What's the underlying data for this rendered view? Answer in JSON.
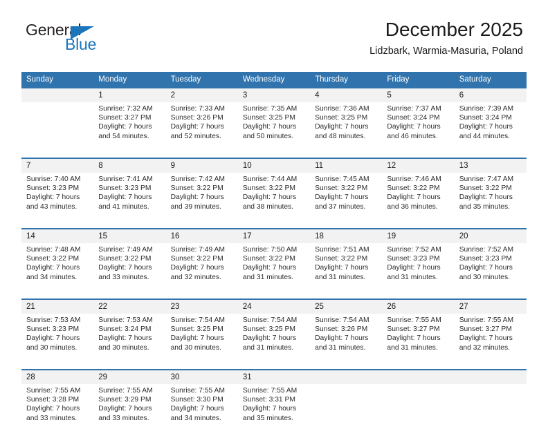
{
  "brand": {
    "line1": "General",
    "line2": "Blue",
    "triangle_icon": "brand-triangle-icon",
    "accent_color": "#1b75bb"
  },
  "header": {
    "title": "December 2025",
    "subtitle": "Lidzbark, Warmia-Masuria, Poland"
  },
  "theme": {
    "header_bg": "#3174ad",
    "daynum_bg": "#f2f2f2",
    "text": "#1a1a1a"
  },
  "weekday_headers": [
    "Sunday",
    "Monday",
    "Tuesday",
    "Wednesday",
    "Thursday",
    "Friday",
    "Saturday"
  ],
  "weeks": [
    {
      "days": [
        {
          "num": "",
          "sunrise": "",
          "sunset": "",
          "daylight1": "",
          "daylight2": ""
        },
        {
          "num": "1",
          "sunrise": "Sunrise: 7:32 AM",
          "sunset": "Sunset: 3:27 PM",
          "daylight1": "Daylight: 7 hours",
          "daylight2": "and 54 minutes."
        },
        {
          "num": "2",
          "sunrise": "Sunrise: 7:33 AM",
          "sunset": "Sunset: 3:26 PM",
          "daylight1": "Daylight: 7 hours",
          "daylight2": "and 52 minutes."
        },
        {
          "num": "3",
          "sunrise": "Sunrise: 7:35 AM",
          "sunset": "Sunset: 3:25 PM",
          "daylight1": "Daylight: 7 hours",
          "daylight2": "and 50 minutes."
        },
        {
          "num": "4",
          "sunrise": "Sunrise: 7:36 AM",
          "sunset": "Sunset: 3:25 PM",
          "daylight1": "Daylight: 7 hours",
          "daylight2": "and 48 minutes."
        },
        {
          "num": "5",
          "sunrise": "Sunrise: 7:37 AM",
          "sunset": "Sunset: 3:24 PM",
          "daylight1": "Daylight: 7 hours",
          "daylight2": "and 46 minutes."
        },
        {
          "num": "6",
          "sunrise": "Sunrise: 7:39 AM",
          "sunset": "Sunset: 3:24 PM",
          "daylight1": "Daylight: 7 hours",
          "daylight2": "and 44 minutes."
        }
      ]
    },
    {
      "days": [
        {
          "num": "7",
          "sunrise": "Sunrise: 7:40 AM",
          "sunset": "Sunset: 3:23 PM",
          "daylight1": "Daylight: 7 hours",
          "daylight2": "and 43 minutes."
        },
        {
          "num": "8",
          "sunrise": "Sunrise: 7:41 AM",
          "sunset": "Sunset: 3:23 PM",
          "daylight1": "Daylight: 7 hours",
          "daylight2": "and 41 minutes."
        },
        {
          "num": "9",
          "sunrise": "Sunrise: 7:42 AM",
          "sunset": "Sunset: 3:22 PM",
          "daylight1": "Daylight: 7 hours",
          "daylight2": "and 39 minutes."
        },
        {
          "num": "10",
          "sunrise": "Sunrise: 7:44 AM",
          "sunset": "Sunset: 3:22 PM",
          "daylight1": "Daylight: 7 hours",
          "daylight2": "and 38 minutes."
        },
        {
          "num": "11",
          "sunrise": "Sunrise: 7:45 AM",
          "sunset": "Sunset: 3:22 PM",
          "daylight1": "Daylight: 7 hours",
          "daylight2": "and 37 minutes."
        },
        {
          "num": "12",
          "sunrise": "Sunrise: 7:46 AM",
          "sunset": "Sunset: 3:22 PM",
          "daylight1": "Daylight: 7 hours",
          "daylight2": "and 36 minutes."
        },
        {
          "num": "13",
          "sunrise": "Sunrise: 7:47 AM",
          "sunset": "Sunset: 3:22 PM",
          "daylight1": "Daylight: 7 hours",
          "daylight2": "and 35 minutes."
        }
      ]
    },
    {
      "days": [
        {
          "num": "14",
          "sunrise": "Sunrise: 7:48 AM",
          "sunset": "Sunset: 3:22 PM",
          "daylight1": "Daylight: 7 hours",
          "daylight2": "and 34 minutes."
        },
        {
          "num": "15",
          "sunrise": "Sunrise: 7:49 AM",
          "sunset": "Sunset: 3:22 PM",
          "daylight1": "Daylight: 7 hours",
          "daylight2": "and 33 minutes."
        },
        {
          "num": "16",
          "sunrise": "Sunrise: 7:49 AM",
          "sunset": "Sunset: 3:22 PM",
          "daylight1": "Daylight: 7 hours",
          "daylight2": "and 32 minutes."
        },
        {
          "num": "17",
          "sunrise": "Sunrise: 7:50 AM",
          "sunset": "Sunset: 3:22 PM",
          "daylight1": "Daylight: 7 hours",
          "daylight2": "and 31 minutes."
        },
        {
          "num": "18",
          "sunrise": "Sunrise: 7:51 AM",
          "sunset": "Sunset: 3:22 PM",
          "daylight1": "Daylight: 7 hours",
          "daylight2": "and 31 minutes."
        },
        {
          "num": "19",
          "sunrise": "Sunrise: 7:52 AM",
          "sunset": "Sunset: 3:23 PM",
          "daylight1": "Daylight: 7 hours",
          "daylight2": "and 31 minutes."
        },
        {
          "num": "20",
          "sunrise": "Sunrise: 7:52 AM",
          "sunset": "Sunset: 3:23 PM",
          "daylight1": "Daylight: 7 hours",
          "daylight2": "and 30 minutes."
        }
      ]
    },
    {
      "days": [
        {
          "num": "21",
          "sunrise": "Sunrise: 7:53 AM",
          "sunset": "Sunset: 3:23 PM",
          "daylight1": "Daylight: 7 hours",
          "daylight2": "and 30 minutes."
        },
        {
          "num": "22",
          "sunrise": "Sunrise: 7:53 AM",
          "sunset": "Sunset: 3:24 PM",
          "daylight1": "Daylight: 7 hours",
          "daylight2": "and 30 minutes."
        },
        {
          "num": "23",
          "sunrise": "Sunrise: 7:54 AM",
          "sunset": "Sunset: 3:25 PM",
          "daylight1": "Daylight: 7 hours",
          "daylight2": "and 30 minutes."
        },
        {
          "num": "24",
          "sunrise": "Sunrise: 7:54 AM",
          "sunset": "Sunset: 3:25 PM",
          "daylight1": "Daylight: 7 hours",
          "daylight2": "and 31 minutes."
        },
        {
          "num": "25",
          "sunrise": "Sunrise: 7:54 AM",
          "sunset": "Sunset: 3:26 PM",
          "daylight1": "Daylight: 7 hours",
          "daylight2": "and 31 minutes."
        },
        {
          "num": "26",
          "sunrise": "Sunrise: 7:55 AM",
          "sunset": "Sunset: 3:27 PM",
          "daylight1": "Daylight: 7 hours",
          "daylight2": "and 31 minutes."
        },
        {
          "num": "27",
          "sunrise": "Sunrise: 7:55 AM",
          "sunset": "Sunset: 3:27 PM",
          "daylight1": "Daylight: 7 hours",
          "daylight2": "and 32 minutes."
        }
      ]
    },
    {
      "days": [
        {
          "num": "28",
          "sunrise": "Sunrise: 7:55 AM",
          "sunset": "Sunset: 3:28 PM",
          "daylight1": "Daylight: 7 hours",
          "daylight2": "and 33 minutes."
        },
        {
          "num": "29",
          "sunrise": "Sunrise: 7:55 AM",
          "sunset": "Sunset: 3:29 PM",
          "daylight1": "Daylight: 7 hours",
          "daylight2": "and 33 minutes."
        },
        {
          "num": "30",
          "sunrise": "Sunrise: 7:55 AM",
          "sunset": "Sunset: 3:30 PM",
          "daylight1": "Daylight: 7 hours",
          "daylight2": "and 34 minutes."
        },
        {
          "num": "31",
          "sunrise": "Sunrise: 7:55 AM",
          "sunset": "Sunset: 3:31 PM",
          "daylight1": "Daylight: 7 hours",
          "daylight2": "and 35 minutes."
        },
        {
          "num": "",
          "sunrise": "",
          "sunset": "",
          "daylight1": "",
          "daylight2": ""
        },
        {
          "num": "",
          "sunrise": "",
          "sunset": "",
          "daylight1": "",
          "daylight2": ""
        },
        {
          "num": "",
          "sunrise": "",
          "sunset": "",
          "daylight1": "",
          "daylight2": ""
        }
      ]
    }
  ]
}
